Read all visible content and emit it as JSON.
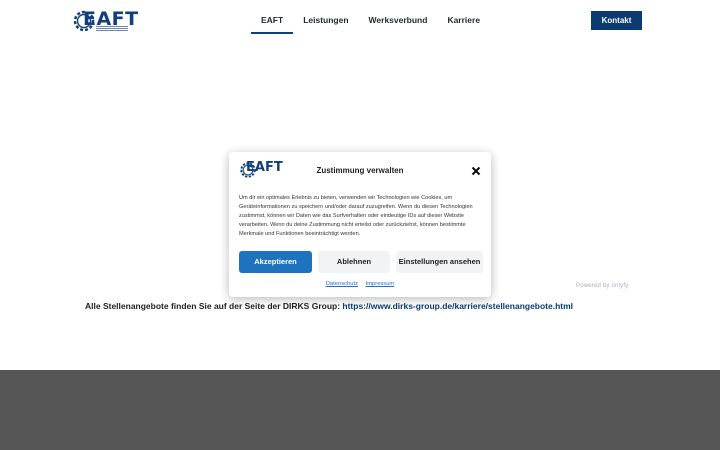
{
  "header": {
    "logo_text": "EAFT",
    "nav": [
      {
        "label": "EAFT",
        "active": true
      },
      {
        "label": "Leistungen",
        "active": false
      },
      {
        "label": "Werksverbund",
        "active": false
      },
      {
        "label": "Karriere",
        "active": false
      }
    ],
    "contact_label": "Kontakt"
  },
  "main": {
    "jobs_prefix": "Alle Stellenangebote finden Sie auf der Seite der DIRKS Group: ",
    "jobs_link": "https://www.dirks-group.de/karriere/stellenangebote.html",
    "powered_by": "Powered by onlyfy"
  },
  "consent": {
    "logo_text": "EAFT",
    "title": "Zustimmung verwalten",
    "body": "Um dir ein optimales Erlebnis zu bieten, verwenden wir Technologien wie Cookies, um Geräteinformationen zu speichern und/oder darauf zuzugreifen. Wenn du diesen Technologien zustimmst, können wir Daten wie das Surfverhalten oder eindeutige IDs auf dieser Website verarbeiten. Wenn du deine Zustimmung nicht erteilst oder zurückziehst, können bestimmte Merkmale und Funktionen beeinträchtigt werden.",
    "accept_label": "Akzeptieren",
    "deny_label": "Ablehnen",
    "settings_label": "Einstellungen ansehen",
    "privacy_link": "Datenschutz",
    "imprint_link": "Impressum"
  },
  "colors": {
    "brand_navy": "#0b3b70",
    "accept_blue": "#1e73be",
    "footer_gray": "#555555"
  }
}
